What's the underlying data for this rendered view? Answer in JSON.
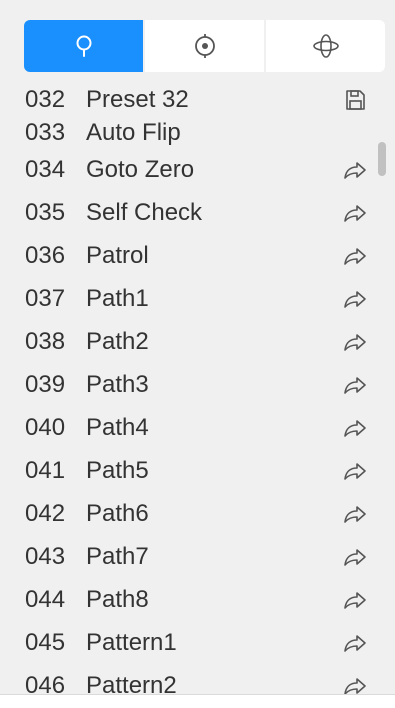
{
  "tabs": [
    {
      "id": "preset",
      "icon": "map-pin-icon",
      "active": true
    },
    {
      "id": "patrol",
      "icon": "target-icon",
      "active": false
    },
    {
      "id": "pattern",
      "icon": "orbit-icon",
      "active": false
    }
  ],
  "colors": {
    "accent": "#1a90ff",
    "background": "#f0f0f0",
    "text": "#333333",
    "icon": "#555555"
  },
  "presets": [
    {
      "num": "032",
      "name": "Preset 32",
      "action": "save-icon"
    },
    {
      "num": "033",
      "name": "Auto Flip",
      "action": ""
    },
    {
      "num": "034",
      "name": "Goto Zero",
      "action": "goto-arrow-icon"
    },
    {
      "num": "035",
      "name": "Self Check",
      "action": "goto-arrow-icon"
    },
    {
      "num": "036",
      "name": "Patrol",
      "action": "goto-arrow-icon"
    },
    {
      "num": "037",
      "name": "Path1",
      "action": "goto-arrow-icon"
    },
    {
      "num": "038",
      "name": "Path2",
      "action": "goto-arrow-icon"
    },
    {
      "num": "039",
      "name": "Path3",
      "action": "goto-arrow-icon"
    },
    {
      "num": "040",
      "name": "Path4",
      "action": "goto-arrow-icon"
    },
    {
      "num": "041",
      "name": "Path5",
      "action": "goto-arrow-icon"
    },
    {
      "num": "042",
      "name": "Path6",
      "action": "goto-arrow-icon"
    },
    {
      "num": "043",
      "name": "Path7",
      "action": "goto-arrow-icon"
    },
    {
      "num": "044",
      "name": "Path8",
      "action": "goto-arrow-icon"
    },
    {
      "num": "045",
      "name": "Pattern1",
      "action": "goto-arrow-icon"
    },
    {
      "num": "046",
      "name": "Pattern2",
      "action": "goto-arrow-icon"
    }
  ]
}
